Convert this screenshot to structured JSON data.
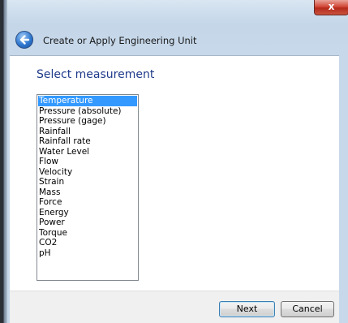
{
  "window": {
    "title": "Create or Apply Engineering Unit",
    "close_label": "x"
  },
  "main": {
    "heading": "Select measurement",
    "measurements": [
      {
        "label": "Temperature",
        "selected": true
      },
      {
        "label": "Pressure (absolute)",
        "selected": false
      },
      {
        "label": "Pressure (gage)",
        "selected": false
      },
      {
        "label": "Rainfall",
        "selected": false
      },
      {
        "label": "Rainfall rate",
        "selected": false
      },
      {
        "label": "Water Level",
        "selected": false
      },
      {
        "label": "Flow",
        "selected": false
      },
      {
        "label": "Velocity",
        "selected": false
      },
      {
        "label": "Strain",
        "selected": false
      },
      {
        "label": "Mass",
        "selected": false
      },
      {
        "label": "Force",
        "selected": false
      },
      {
        "label": "Energy",
        "selected": false
      },
      {
        "label": "Power",
        "selected": false
      },
      {
        "label": "Torque",
        "selected": false
      },
      {
        "label": "CO2",
        "selected": false
      },
      {
        "label": "pH",
        "selected": false
      }
    ]
  },
  "footer": {
    "next_label": "Next",
    "cancel_label": "Cancel"
  },
  "icons": {
    "back": "back-arrow-icon",
    "close": "close-icon"
  },
  "colors": {
    "selection": "#3399ff",
    "heading": "#1e3a8a",
    "close_button": "#c9523d"
  }
}
